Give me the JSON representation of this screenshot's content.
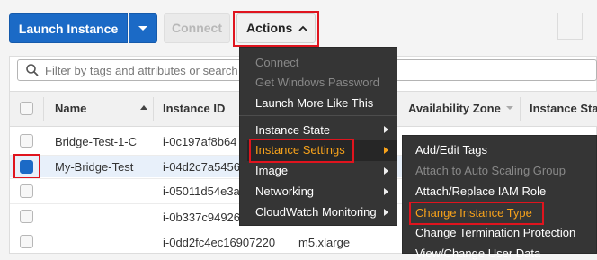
{
  "toolbar": {
    "launch_label": "Launch Instance",
    "connect_label": "Connect",
    "actions_label": "Actions"
  },
  "search": {
    "placeholder": "Filter by tags and attributes or search"
  },
  "table": {
    "headers": {
      "name": "Name",
      "instance_id": "Instance ID",
      "az": "Availability Zone",
      "state": "Instance Sta"
    },
    "rows": [
      {
        "name": "Bridge-Test-1-C",
        "id": "i-0c197af8b64",
        "type": ""
      },
      {
        "name": "My-Bridge-Test",
        "id": "i-04d2c7a5456",
        "type": "",
        "selected": true
      },
      {
        "name": "",
        "id": "i-05011d54e3a",
        "type": ""
      },
      {
        "name": "",
        "id": "i-0b337c94926",
        "type": ""
      },
      {
        "name": "",
        "id": "i-0dd2fc4ec16907220",
        "type": "m5.xlarge"
      }
    ]
  },
  "actions_menu": {
    "items": [
      {
        "label": "Connect",
        "disabled": true
      },
      {
        "label": "Get Windows Password",
        "disabled": true
      },
      {
        "label": "Launch More Like This"
      },
      {
        "label": "Instance State",
        "submenu": true
      },
      {
        "label": "Instance Settings",
        "submenu": true,
        "highlighted": true
      },
      {
        "label": "Image",
        "submenu": true
      },
      {
        "label": "Networking",
        "submenu": true
      },
      {
        "label": "CloudWatch Monitoring",
        "submenu": true
      }
    ]
  },
  "settings_menu": {
    "items": [
      {
        "label": "Add/Edit Tags"
      },
      {
        "label": "Attach to Auto Scaling Group",
        "disabled": true
      },
      {
        "label": "Attach/Replace IAM Role"
      },
      {
        "label": "Change Instance Type",
        "highlighted": true
      },
      {
        "label": "Change Termination Protection"
      },
      {
        "label": "View/Change User Data"
      }
    ]
  },
  "colors": {
    "primary": "#1b6ac6",
    "menu_bg": "#353535",
    "highlight_text": "#f7a21b",
    "annotation_red": "#e0141e"
  }
}
